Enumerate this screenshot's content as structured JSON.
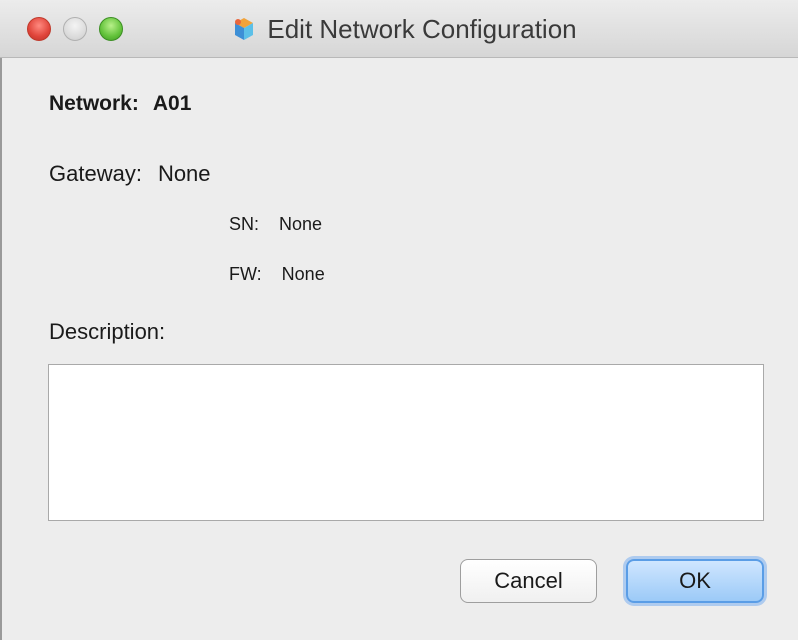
{
  "window": {
    "title": "Edit Network Configuration",
    "icon": "network-configuration-app-icon"
  },
  "network": {
    "label": "Network:",
    "value": "A01"
  },
  "gateway": {
    "label": "Gateway:",
    "value": "None"
  },
  "sn": {
    "label": "SN:",
    "value": "None"
  },
  "fw": {
    "label": "FW:",
    "value": "None"
  },
  "description": {
    "label": "Description:",
    "value": ""
  },
  "buttons": {
    "cancel": "Cancel",
    "ok": "OK"
  },
  "colors": {
    "close": "#e0443a",
    "minimize": "#d8d8d8",
    "zoom": "#62c23a",
    "default_button": "#9ccaf7"
  }
}
